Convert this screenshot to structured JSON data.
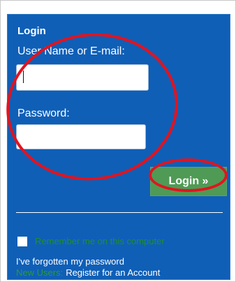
{
  "login": {
    "title": "Login",
    "username_label": "User Name or E-mail:",
    "username_value": "",
    "password_label": "Password:",
    "password_value": "",
    "login_button": "Login »",
    "remember_label": "Remember me on this computer",
    "forgot_link": "I've forgotten my password",
    "new_users_prefix": "New Users:",
    "register_link": "Register for an Account"
  },
  "colors": {
    "panel_bg": "#0f5fb7",
    "button_bg": "#4f9a55",
    "annotation": "#e3131e"
  }
}
